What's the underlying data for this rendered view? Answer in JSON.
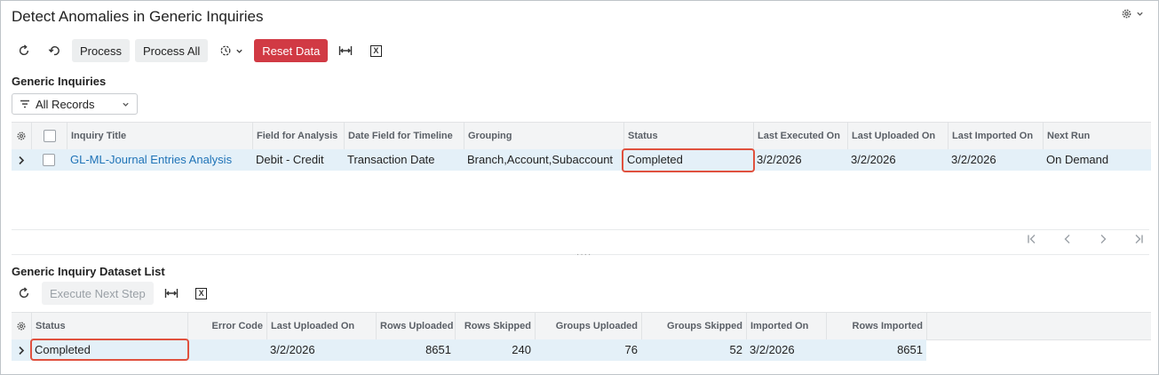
{
  "page": {
    "title": "Detect Anomalies in Generic Inquiries"
  },
  "toolbar": {
    "process_label": "Process",
    "process_all_label": "Process All",
    "reset_data_label": "Reset Data"
  },
  "generic_inquiries": {
    "section_title": "Generic Inquiries",
    "filter_value": "All Records",
    "columns": [
      "Inquiry Title",
      "Field for Analysis",
      "Date Field for Timeline",
      "Grouping",
      "Status",
      "Last Executed On",
      "Last Uploaded On",
      "Last Imported On",
      "Next Run"
    ],
    "rows": [
      {
        "inquiry_title": "GL-ML-Journal Entries Analysis",
        "field_for_analysis": "Debit - Credit",
        "date_field": "Transaction Date",
        "grouping": "Branch,Account,Subaccount",
        "status": "Completed",
        "last_executed_on": "3/2/2026",
        "last_uploaded_on": "3/2/2026",
        "last_imported_on": "3/2/2026",
        "next_run": "On Demand"
      }
    ]
  },
  "dataset_list": {
    "section_title": "Generic Inquiry Dataset List",
    "execute_next_step_label": "Execute Next Step",
    "columns": [
      "Status",
      "Error Code",
      "Last Uploaded On",
      "Rows Uploaded",
      "Rows Skipped",
      "Groups Uploaded",
      "Groups Skipped",
      "Imported On",
      "Rows Imported"
    ],
    "rows": [
      {
        "status": "Completed",
        "error_code": "",
        "last_uploaded_on": "3/2/2026",
        "rows_uploaded": "8651",
        "rows_skipped": "240",
        "groups_uploaded": "76",
        "groups_skipped": "52",
        "imported_on": "3/2/2026",
        "rows_imported": "8651"
      }
    ]
  },
  "colors": {
    "accent_red": "#d13a44",
    "link": "#1f73b7",
    "selected_row": "#e4f0f8",
    "highlight": "#e0513e"
  },
  "icons": [
    "refresh-icon",
    "undo-icon",
    "schedule-icon",
    "fit-columns-icon",
    "excel-export-icon",
    "settings-icon",
    "filter-icon"
  ]
}
